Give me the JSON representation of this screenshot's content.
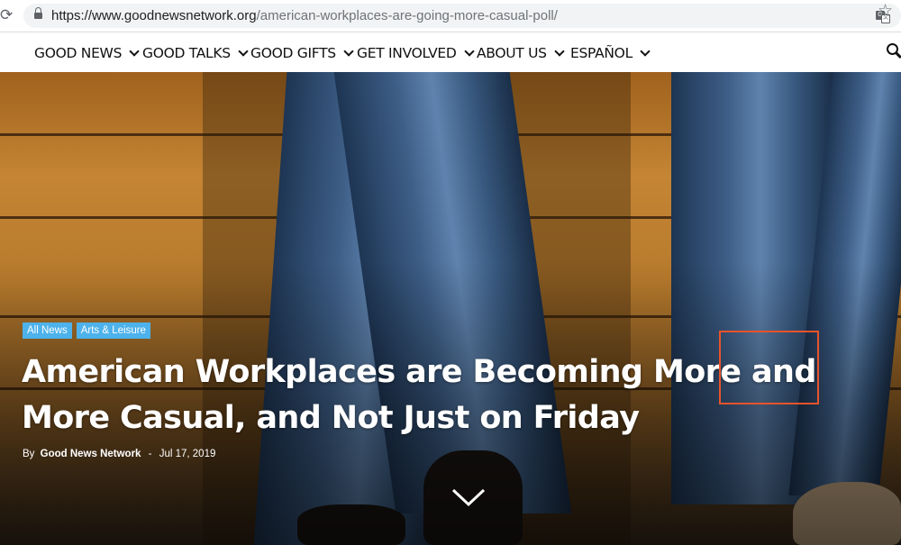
{
  "browser": {
    "url_host": "https://www.goodnewsnetwork.org",
    "url_path": "/american-workplaces-are-going-more-casual-poll/"
  },
  "nav": {
    "items": [
      {
        "label": "GOOD NEWS"
      },
      {
        "label": "GOOD TALKS"
      },
      {
        "label": "GOOD GIFTS"
      },
      {
        "label": "GET INVOLVED"
      },
      {
        "label": "ABOUT US"
      },
      {
        "label": "ESPAÑOL"
      }
    ]
  },
  "article": {
    "tags": [
      "All News",
      "Arts & Leisure"
    ],
    "title": "American Workplaces are Becoming More and More Casual, and Not Just on Friday",
    "byline_prefix": "By",
    "author": "Good News Network",
    "separator": "-",
    "date": "Jul 17, 2019"
  },
  "colors": {
    "tag_bg": "#4db2ec",
    "highlight_border": "#e8532b"
  },
  "icons": [
    "reload-icon",
    "lock-icon",
    "translate-icon",
    "star-icon",
    "chevron-down-icon",
    "search-icon",
    "scroll-down-icon"
  ]
}
